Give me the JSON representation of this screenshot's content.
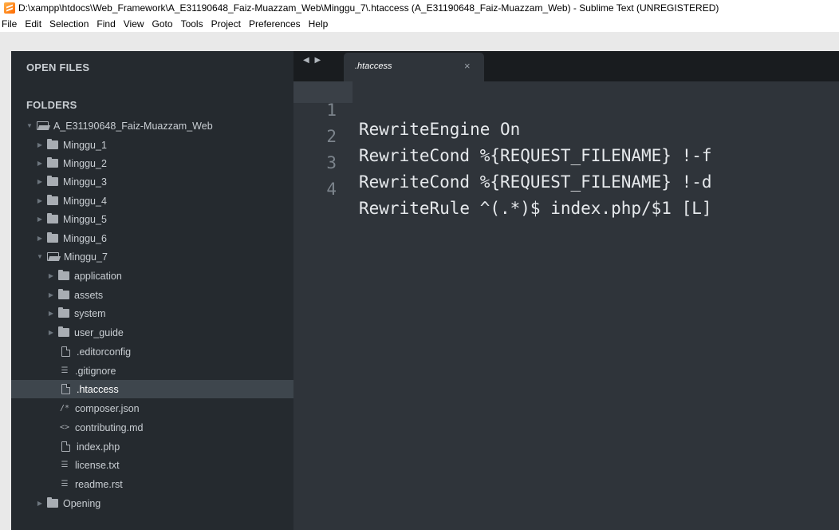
{
  "window": {
    "title": "D:\\xampp\\htdocs\\Web_Framework\\A_E31190648_Faiz-Muazzam_Web\\Minggu_7\\.htaccess (A_E31190648_Faiz-Muazzam_Web) - Sublime Text (UNREGISTERED)",
    "icon": "sublime-text-icon"
  },
  "menu": [
    "File",
    "Edit",
    "Selection",
    "Find",
    "View",
    "Goto",
    "Tools",
    "Project",
    "Preferences",
    "Help"
  ],
  "sidebar": {
    "open_files_label": "OPEN FILES",
    "folders_label": "FOLDERS",
    "tree": [
      {
        "label": "A_E31190648_Faiz-Muazzam_Web",
        "type": "folder",
        "expanded": true
      },
      {
        "label": "Minggu_1",
        "type": "folder"
      },
      {
        "label": "Minggu_2",
        "type": "folder"
      },
      {
        "label": "Minggu_3",
        "type": "folder"
      },
      {
        "label": "Minggu_4",
        "type": "folder"
      },
      {
        "label": "Minggu_5",
        "type": "folder"
      },
      {
        "label": "Minggu_6",
        "type": "folder"
      },
      {
        "label": "Minggu_7",
        "type": "folder",
        "expanded": true
      },
      {
        "label": "application",
        "type": "folder"
      },
      {
        "label": "assets",
        "type": "folder"
      },
      {
        "label": "system",
        "type": "folder"
      },
      {
        "label": "user_guide",
        "type": "folder"
      },
      {
        "label": ".editorconfig",
        "type": "file"
      },
      {
        "label": ".gitignore",
        "type": "text-file"
      },
      {
        "label": ".htaccess",
        "type": "file",
        "selected": true
      },
      {
        "label": "composer.json",
        "type": "json-file"
      },
      {
        "label": "contributing.md",
        "type": "markup-file"
      },
      {
        "label": "index.php",
        "type": "file"
      },
      {
        "label": "license.txt",
        "type": "text-file"
      },
      {
        "label": "readme.rst",
        "type": "text-file"
      },
      {
        "label": "Opening",
        "type": "folder"
      }
    ]
  },
  "tabs": [
    {
      "label": ".htaccess",
      "close": "×",
      "active": true
    }
  ],
  "nav_arrows": "◀ ▶",
  "editor": {
    "current_line": 1,
    "lines": [
      {
        "number": "1",
        "text": "RewriteEngine On"
      },
      {
        "number": "2",
        "text": "RewriteCond %{REQUEST_FILENAME} !-f"
      },
      {
        "number": "3",
        "text": "RewriteCond %{REQUEST_FILENAME} !-d"
      },
      {
        "number": "4",
        "text": "RewriteRule ^(.*)$ index.php/$1 [L]"
      }
    ]
  },
  "colors": {
    "sidebar_bg": "#252a2f",
    "editor_bg": "#2f343a",
    "tabbar_bg": "#191c1f",
    "selected_row": "#3e464d"
  }
}
